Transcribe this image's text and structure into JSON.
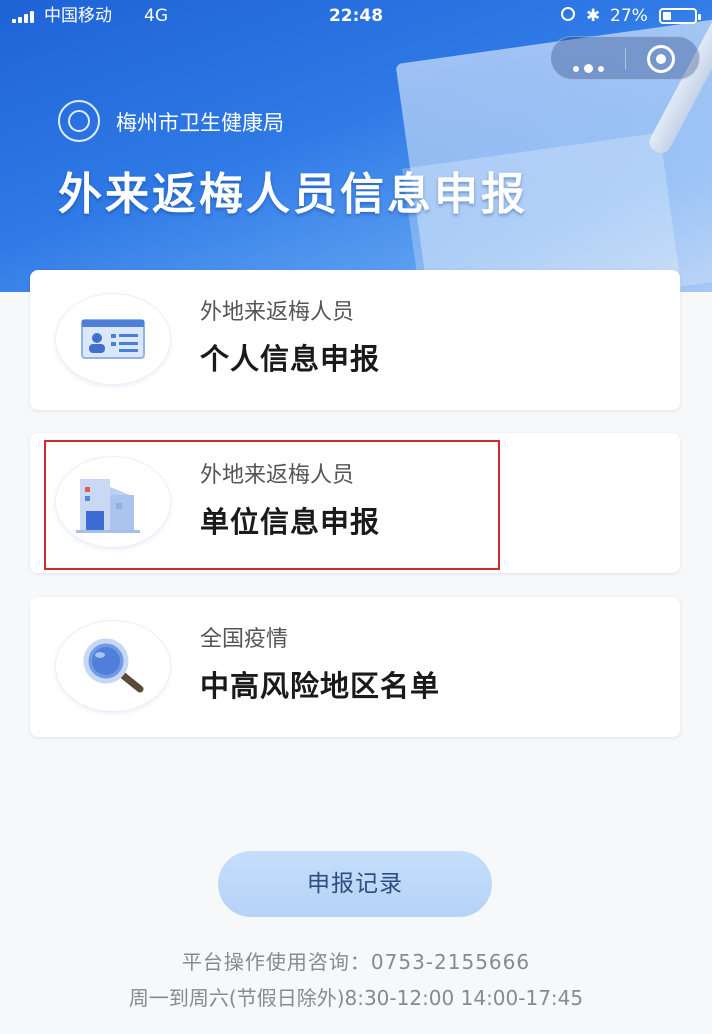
{
  "status_bar": {
    "carrier": "中国移动",
    "network": "4G",
    "time": "22:48",
    "battery": "27%",
    "battery_level": 0.27
  },
  "banner": {
    "org_name": "梅州市卫生健康局",
    "title": "外来返梅人员信息申报"
  },
  "cards": [
    {
      "subtitle": "外地来返梅人员",
      "title": "个人信息申报",
      "icon": "id-card-icon"
    },
    {
      "subtitle": "外地来返梅人员",
      "title": "单位信息申报",
      "icon": "building-icon"
    },
    {
      "subtitle": "全国疫情",
      "title": "中高风险地区名单",
      "icon": "magnifier-icon"
    }
  ],
  "record_button": "申报记录",
  "footer": {
    "line1": "平台操作使用咨询：0753-2155666",
    "line2": "周一到周六(节假日除外)8:30-12:00 14:00-17:45"
  },
  "colors": {
    "banner": "#2f7ae6",
    "highlight": "#d12a2a",
    "button": "#c5defb"
  }
}
